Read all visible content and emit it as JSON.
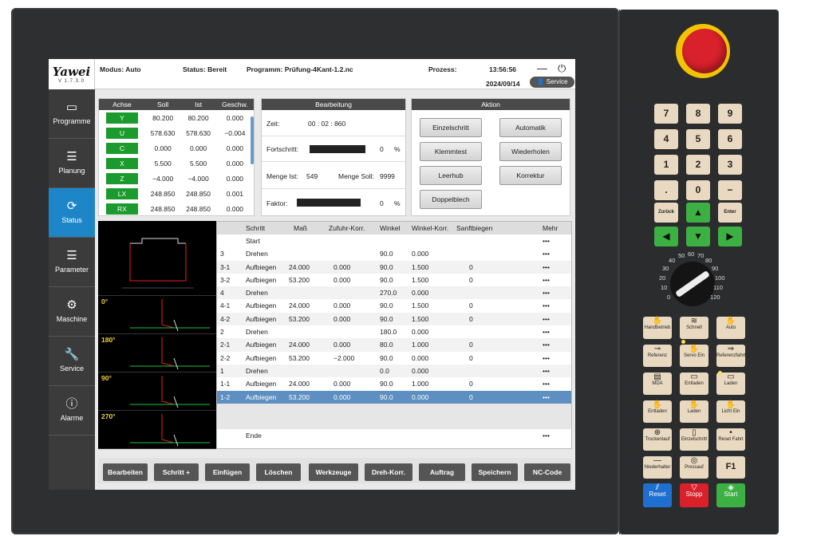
{
  "brand": {
    "name": "Yawei",
    "version": "V 1.7.3.0"
  },
  "header": {
    "mode": "Modus: Auto",
    "status": "Status: Bereit",
    "program": "Programm: Prüfung-4Kant-1.2.nc",
    "process": "Prozess:",
    "time": "13:56:56",
    "date": "2024/09/14",
    "minimize": "—",
    "power": "⏻",
    "service": "Service"
  },
  "nav": [
    {
      "label": "Programme",
      "icon": "folder-icon",
      "glyph": "▭"
    },
    {
      "label": "Planung",
      "icon": "list-icon",
      "glyph": "☰"
    },
    {
      "label": "Status",
      "icon": "sync-icon",
      "glyph": "⟳"
    },
    {
      "label": "Parameter",
      "icon": "list-icon",
      "glyph": "☰"
    },
    {
      "label": "Maschine",
      "icon": "gear-icon",
      "glyph": "⚙"
    },
    {
      "label": "Service",
      "icon": "wrench-icon",
      "glyph": "🔧"
    },
    {
      "label": "Alarme",
      "icon": "alert-icon",
      "glyph": "ⓘ"
    }
  ],
  "axes": {
    "headers": [
      "Achse",
      "Soll",
      "Ist",
      "Geschw."
    ],
    "rows": [
      {
        "name": "Y",
        "soll": "80.200",
        "ist": "80.200",
        "v": "0.000"
      },
      {
        "name": "U",
        "soll": "578.630",
        "ist": "578.630",
        "v": "−0.004"
      },
      {
        "name": "C",
        "soll": "0.000",
        "ist": "0.000",
        "v": "0.000"
      },
      {
        "name": "X",
        "soll": "5.500",
        "ist": "5.500",
        "v": "0.000"
      },
      {
        "name": "Z",
        "soll": "−4.000",
        "ist": "−4.000",
        "v": "0.000"
      },
      {
        "name": "LX",
        "soll": "248.850",
        "ist": "248.850",
        "v": "0.001"
      },
      {
        "name": "RX",
        "soll": "248.850",
        "ist": "248.850",
        "v": "0.000"
      }
    ]
  },
  "processing": {
    "title": "Bearbeitung",
    "time_label": "Zeit:",
    "time_value": "00 : 02 : 860",
    "progress_label": "Fortschritt:",
    "progress_value": "0",
    "progress_unit": "%",
    "qty_ist_label": "Menge Ist:",
    "qty_ist": "549",
    "qty_soll_label": "Menge Soll:",
    "qty_soll": "9999",
    "factor_label": "Faktor:",
    "factor_value": "0",
    "factor_unit": "%"
  },
  "actions": {
    "title": "Aktion",
    "buttons": [
      "Einzelschritt",
      "Automatik",
      "Klemmtest",
      "Wiederholen",
      "Leerhub",
      "Korrektur",
      "Doppelblech"
    ]
  },
  "graph": {
    "angles": [
      "0°",
      "180°",
      "90°",
      "270°"
    ]
  },
  "program": {
    "headers": [
      "Schritt",
      "Maß",
      "Zufuhr-Korr.",
      "Winkel",
      "Winkel-Korr.",
      "Sanftbiegen",
      "Mehr"
    ],
    "start": "Start",
    "end": "Ende",
    "more": "•••",
    "rows": [
      {
        "n": "3",
        "s": "Drehen",
        "m": "",
        "z": "",
        "w": "90.0",
        "wk": "0.000",
        "sb": ""
      },
      {
        "n": "3-1",
        "s": "Aufbiegen",
        "m": "24.000",
        "z": "0.000",
        "w": "90.0",
        "wk": "1.500",
        "sb": "0"
      },
      {
        "n": "3-2",
        "s": "Aufbiegen",
        "m": "53.200",
        "z": "0.000",
        "w": "90.0",
        "wk": "1.500",
        "sb": "0"
      },
      {
        "n": "4",
        "s": "Drehen",
        "m": "",
        "z": "",
        "w": "270.0",
        "wk": "0.000",
        "sb": ""
      },
      {
        "n": "4-1",
        "s": "Aufbiegen",
        "m": "24.000",
        "z": "0.000",
        "w": "90.0",
        "wk": "1.500",
        "sb": "0"
      },
      {
        "n": "4-2",
        "s": "Aufbiegen",
        "m": "53.200",
        "z": "0.000",
        "w": "90.0",
        "wk": "1.500",
        "sb": "0"
      },
      {
        "n": "2",
        "s": "Drehen",
        "m": "",
        "z": "",
        "w": "180.0",
        "wk": "0.000",
        "sb": ""
      },
      {
        "n": "2-1",
        "s": "Aufbiegen",
        "m": "24.000",
        "z": "0.000",
        "w": "80.0",
        "wk": "1.000",
        "sb": "0"
      },
      {
        "n": "2-2",
        "s": "Aufbiegen",
        "m": "53.200",
        "z": "−2.000",
        "w": "90.0",
        "wk": "0.000",
        "sb": "0"
      },
      {
        "n": "1",
        "s": "Drehen",
        "m": "",
        "z": "",
        "w": "0.0",
        "wk": "0.000",
        "sb": ""
      },
      {
        "n": "1-1",
        "s": "Aufbiegen",
        "m": "24.000",
        "z": "0.000",
        "w": "90.0",
        "wk": "1.000",
        "sb": "0"
      },
      {
        "n": "1-2",
        "s": "Aufbiegen",
        "m": "53.200",
        "z": "0.000",
        "w": "90.0",
        "wk": "0.000",
        "sb": "0"
      }
    ]
  },
  "bottom": [
    "Bearbeiten",
    "Schritt +",
    "Einfügen",
    "Löschen",
    "Werkzeuge",
    "Dreh-Korr.",
    "Auftrag",
    "Speichern",
    "NC-Code"
  ],
  "keypad": {
    "digits": [
      "7",
      "8",
      "9",
      "4",
      "5",
      "6",
      "1",
      "2",
      "3",
      ".",
      "0",
      "−"
    ],
    "back": "Zurück",
    "enter": "Enter",
    "dial_labels": [
      "0",
      "10",
      "20",
      "30",
      "40",
      "50",
      "60",
      "70",
      "80",
      "90",
      "100",
      "110",
      "120"
    ],
    "fkeys": [
      "Handbetrieb",
      "Schnell",
      "Auto",
      "Referenz",
      "Servo Ein",
      "Referenzfahrt",
      "MDA",
      "Entladen",
      "Laden",
      "Entladen",
      "Laden",
      "Licht Ein",
      "Trockenlauf",
      "Einzelschritt",
      "Reset Fahrt",
      "Niederhalter",
      "Pressauf",
      "F1"
    ],
    "reset": "Reset",
    "stop": "Stopp",
    "start": "Start"
  },
  "colors": {
    "accent": "#1d86c8",
    "axis_green": "#1b9a2e",
    "selected_row": "#5d8fc0"
  }
}
